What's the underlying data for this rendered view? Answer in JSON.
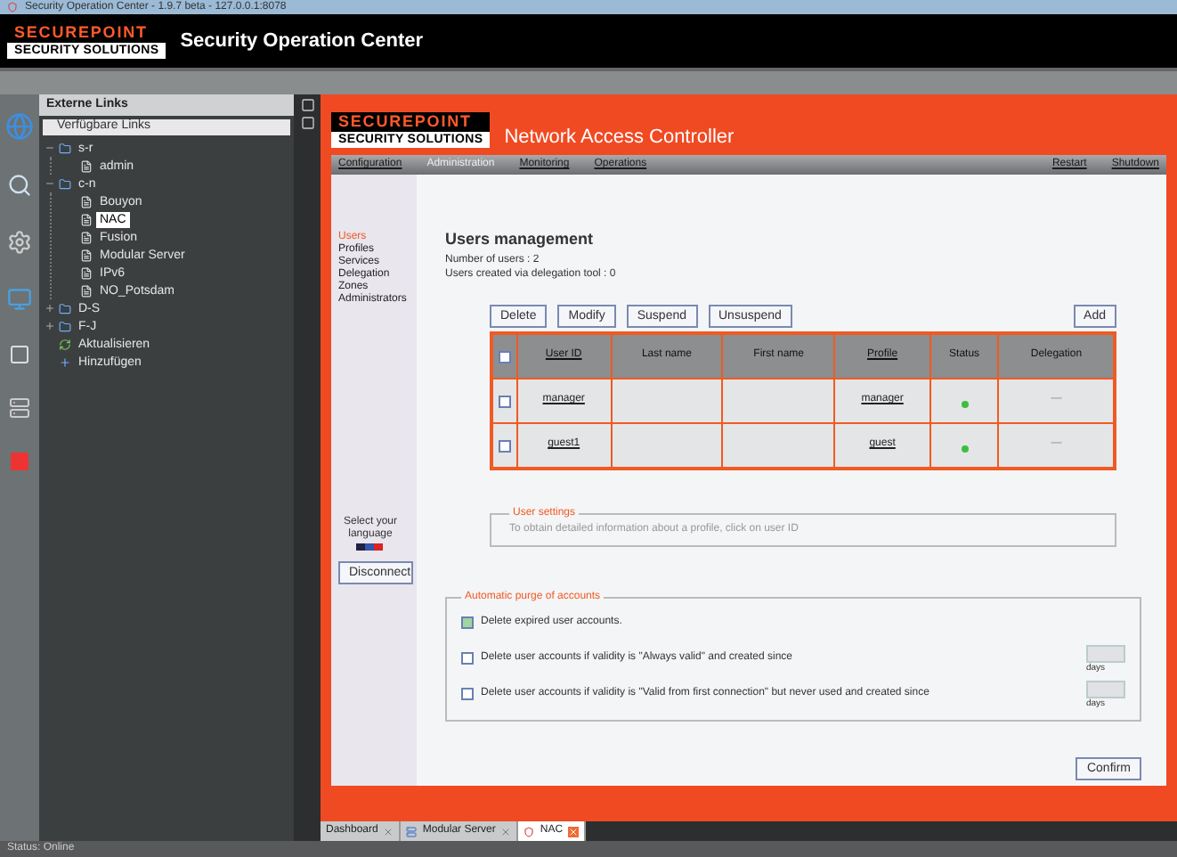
{
  "window": {
    "title": "Security Operation Center - 1.9.7 beta - 127.0.0.1:8078"
  },
  "header": {
    "brand_top": "SECUREPOINT",
    "brand_bottom": "SECURITY SOLUTIONS",
    "title": "Security Operation Center"
  },
  "links_panel": {
    "title": "Externe Links",
    "subtitle": "Verfügbare Links",
    "tree": [
      {
        "label": "s-r",
        "kind": "group",
        "expanded": true,
        "selected": false,
        "children": [
          {
            "label": "admin",
            "kind": "link",
            "selected": false
          }
        ]
      },
      {
        "label": "c-n",
        "kind": "group",
        "expanded": true,
        "selected": false,
        "children": [
          {
            "label": "Bouyon",
            "kind": "link",
            "selected": false
          },
          {
            "label": "NAC",
            "kind": "link",
            "selected": true
          },
          {
            "label": "Fusion",
            "kind": "link",
            "selected": false
          },
          {
            "label": "Modular Server",
            "kind": "link",
            "selected": false
          },
          {
            "label": "IPv6",
            "kind": "link",
            "selected": false
          },
          {
            "label": "NO_Potsdam",
            "kind": "link",
            "selected": false
          }
        ]
      },
      {
        "label": "D-S",
        "kind": "group",
        "expanded": false,
        "selected": false
      },
      {
        "label": "F-J",
        "kind": "group",
        "expanded": false,
        "selected": false
      },
      {
        "label": "Aktualisieren",
        "kind": "refresh",
        "selected": false
      },
      {
        "label": "Hinzufügen",
        "kind": "add",
        "selected": false
      }
    ]
  },
  "app": {
    "brand_top": "SECUREPOINT",
    "brand_bottom": "SECURITY SOLUTIONS",
    "title": "Network Access Controller",
    "nav": [
      {
        "label": "Configuration",
        "selected": false
      },
      {
        "label": "Administration",
        "selected": true
      },
      {
        "label": "Monitoring",
        "selected": false
      },
      {
        "label": "Operations",
        "selected": false
      }
    ],
    "nav_right": [
      "Restart",
      "Shutdown"
    ],
    "side_menu": [
      {
        "label": "Users",
        "selected": true
      },
      {
        "label": "Profiles",
        "selected": false
      },
      {
        "label": "Services",
        "selected": false
      },
      {
        "label": "Delegation",
        "selected": false
      },
      {
        "label": "Zones",
        "selected": false
      },
      {
        "label": "Administrators",
        "selected": false
      }
    ],
    "language_label": "Select your language",
    "disconnect": "Disconnect",
    "heading": "Users management",
    "stats": [
      "Number of users : 2",
      "Users created via delegation tool : 0"
    ],
    "actions": [
      "Delete",
      "Modify",
      "Suspend",
      "Unsuspend"
    ],
    "add": "Add",
    "table": {
      "columns": [
        "User ID",
        "Last name",
        "First name",
        "Profile",
        "Status",
        "Delegation"
      ],
      "all_checked": false,
      "rows": [
        {
          "checked": false,
          "user_id": "manager",
          "last_name": "",
          "first_name": "",
          "profile": "manager",
          "color": "#3cc03c",
          "delegation": "—"
        },
        {
          "checked": false,
          "user_id": "guest1",
          "last_name": "",
          "first_name": "",
          "profile": "guest",
          "color": "#3cc03c",
          "delegation": "—"
        }
      ]
    },
    "user_settings": {
      "legend": "User settings",
      "text": "To obtain detailed information about a profile, click on user ID"
    },
    "purge": {
      "legend": "Automatic purge of accounts",
      "options": [
        {
          "label": "Delete expired user accounts.",
          "checked": true
        },
        {
          "label": "Delete user accounts if validity is \"Always valid\" and created since",
          "checked": false,
          "unit": "days"
        },
        {
          "label": "Delete user accounts if validity is \"Valid from first connection\" but never used and created since",
          "checked": false,
          "unit": "days"
        }
      ]
    },
    "confirm": "Confirm"
  },
  "tabs": [
    {
      "label": "Dashboard",
      "kind": "plain",
      "selected": false
    },
    {
      "label": "Modular Server",
      "kind": "server",
      "selected": false
    },
    {
      "label": "NAC",
      "kind": "shield",
      "selected": true
    }
  ],
  "status_bar": "Status: Online"
}
